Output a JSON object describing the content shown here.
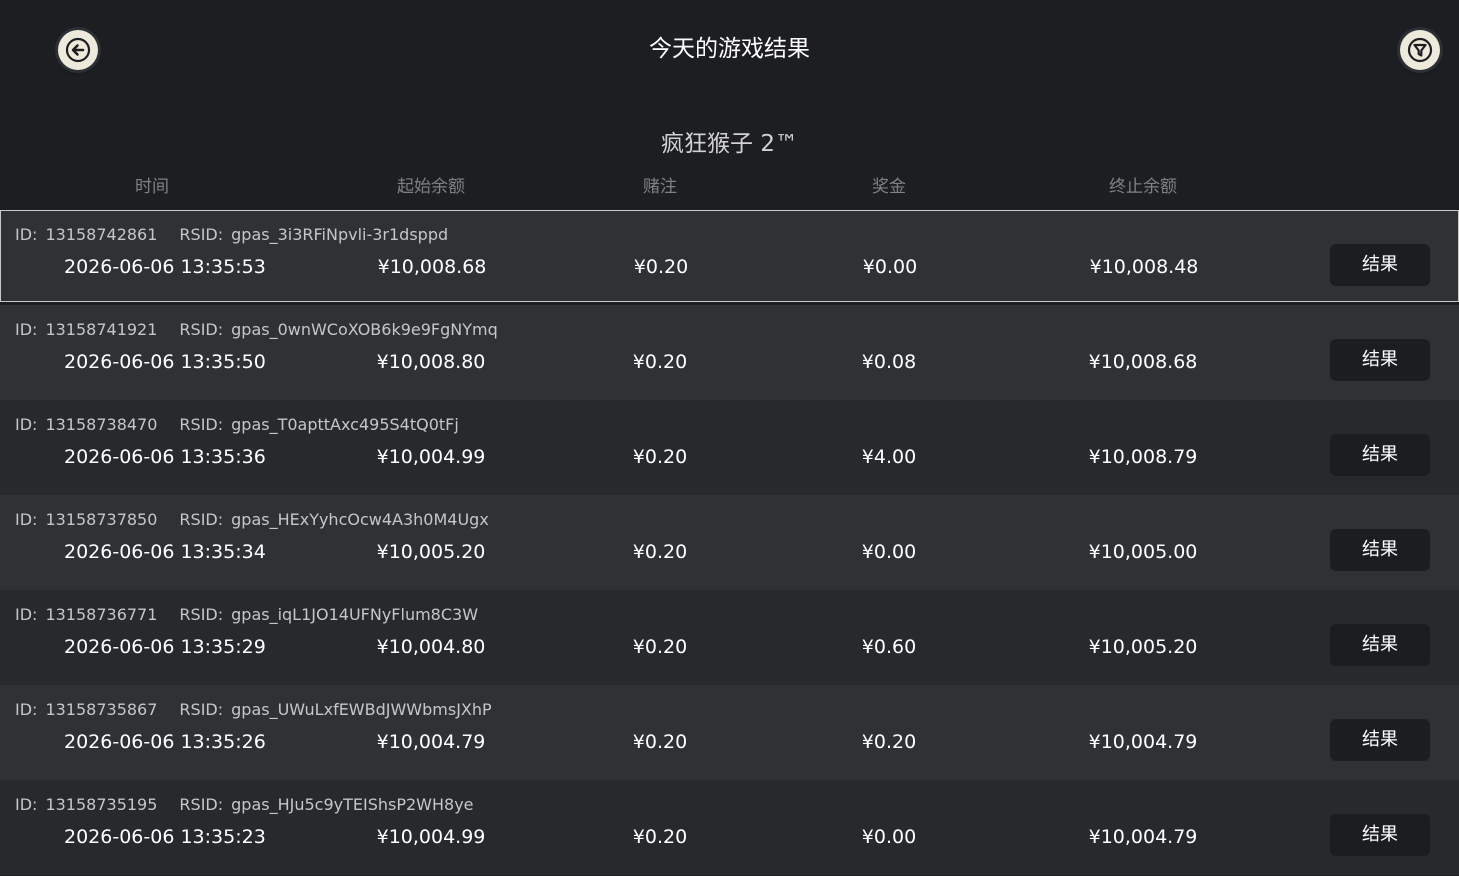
{
  "header": {
    "title": "今天的游戏结果",
    "back_icon": "arrow-left-icon",
    "filter_icon": "funnel-icon"
  },
  "game": {
    "name": "疯狂猴子 2™"
  },
  "columns": [
    "时间",
    "起始余额",
    "赌注",
    "奖金",
    "终止余额"
  ],
  "id_label": "ID:",
  "rsid_label": "RSID:",
  "rows": [
    {
      "id": "13158742861",
      "rsid": "gpas_3i3RFiNpvli-3r1dsppd",
      "time": "2026-06-06 13:35:53",
      "start": "¥10,008.68",
      "bet": "¥0.20",
      "win": "¥0.00",
      "end": "¥10,008.48",
      "button": "结果"
    },
    {
      "id": "13158741921",
      "rsid": "gpas_0wnWCoXOB6k9e9FgNYmq",
      "time": "2026-06-06 13:35:50",
      "start": "¥10,008.80",
      "bet": "¥0.20",
      "win": "¥0.08",
      "end": "¥10,008.68",
      "button": "结果"
    },
    {
      "id": "13158738470",
      "rsid": "gpas_T0apttAxc495S4tQ0tFj",
      "time": "2026-06-06 13:35:36",
      "start": "¥10,004.99",
      "bet": "¥0.20",
      "win": "¥4.00",
      "end": "¥10,008.79",
      "button": "结果"
    },
    {
      "id": "13158737850",
      "rsid": "gpas_HExYyhcOcw4A3h0M4Ugx",
      "time": "2026-06-06 13:35:34",
      "start": "¥10,005.20",
      "bet": "¥0.20",
      "win": "¥0.00",
      "end": "¥10,005.00",
      "button": "结果"
    },
    {
      "id": "13158736771",
      "rsid": "gpas_iqL1JO14UFNyFlum8C3W",
      "time": "2026-06-06 13:35:29",
      "start": "¥10,004.80",
      "bet": "¥0.20",
      "win": "¥0.60",
      "end": "¥10,005.20",
      "button": "结果"
    },
    {
      "id": "13158735867",
      "rsid": "gpas_UWuLxfEWBdJWWbmsJXhP",
      "time": "2026-06-06 13:35:26",
      "start": "¥10,004.79",
      "bet": "¥0.20",
      "win": "¥0.20",
      "end": "¥10,004.79",
      "button": "结果"
    },
    {
      "id": "13158735195",
      "rsid": "gpas_HJu5c9yTEIShsP2WH8ye",
      "time": "2026-06-06 13:35:23",
      "start": "¥10,004.99",
      "bet": "¥0.20",
      "win": "¥0.00",
      "end": "¥10,004.79",
      "button": "结果"
    }
  ],
  "colors": {
    "background": "#1c1e21",
    "row_light": "#2f3235",
    "row_dark": "#272a2d",
    "button_bg": "#1b1d20",
    "icon_bg": "#eeeadb"
  }
}
